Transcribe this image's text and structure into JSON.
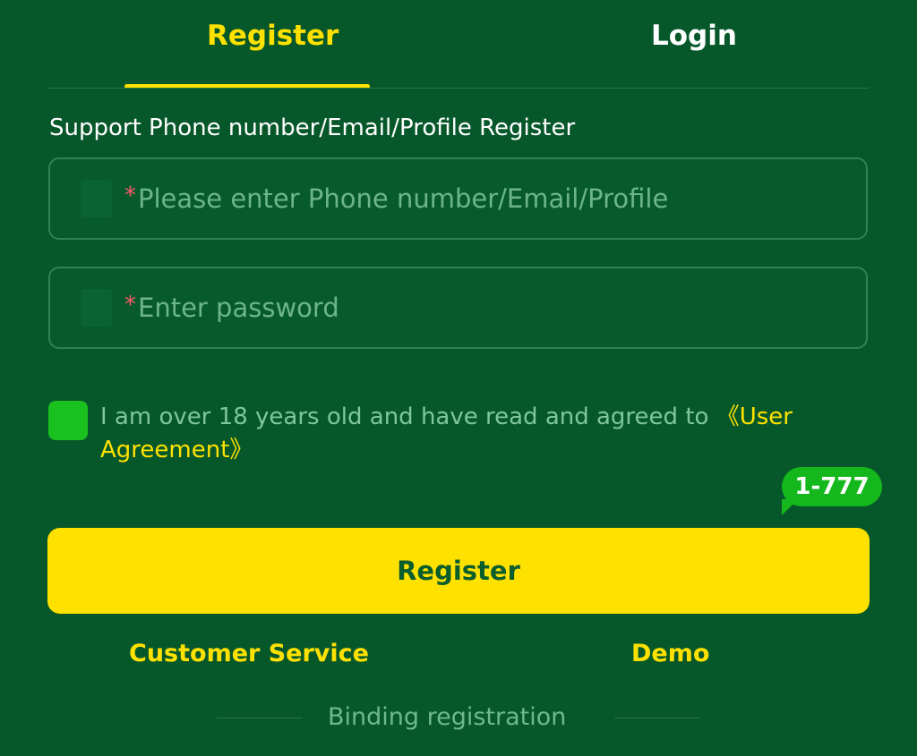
{
  "tabs": {
    "register": "Register",
    "login": "Login"
  },
  "form": {
    "subtitle": "Support Phone number/Email/Profile Register",
    "required_mark": "*",
    "account_placeholder": "Please enter Phone number/Email/Profile",
    "password_placeholder": "Enter password",
    "account_icon": "user-icon",
    "password_icon": "lock-icon"
  },
  "agreement": {
    "text": "I am over 18 years old and have read and agreed to ",
    "link": "《User Agreement》",
    "checked": true
  },
  "badge": {
    "text": "1-777"
  },
  "actions": {
    "register_label": "Register",
    "customer_service": "Customer Service",
    "demo": "Demo",
    "binding_registration": "Binding registration"
  },
  "colors": {
    "background": "#06582a",
    "accent": "#ffe100",
    "checkbox": "#18c11e",
    "required": "#ff5a6a"
  }
}
